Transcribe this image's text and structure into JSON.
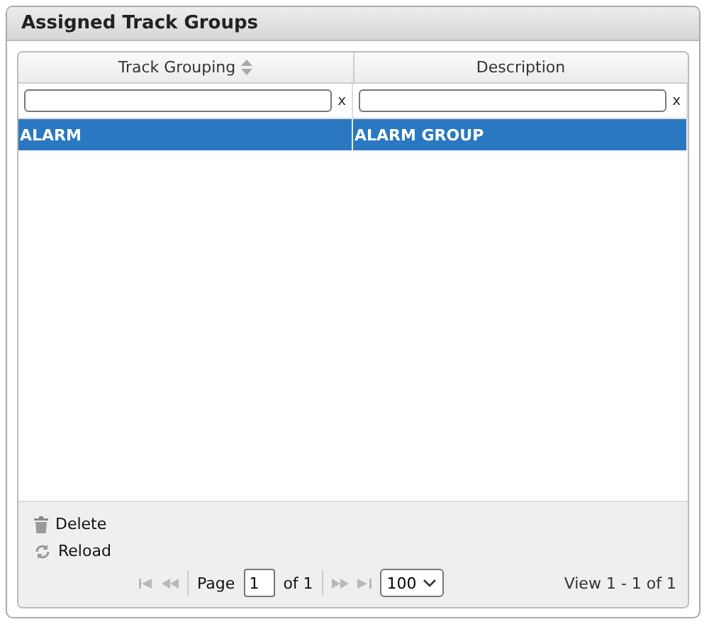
{
  "panel": {
    "title": "Assigned Track Groups"
  },
  "table": {
    "columns": [
      {
        "label": "Track Grouping",
        "sortable": true
      },
      {
        "label": "Description",
        "sortable": false
      }
    ],
    "filters": [
      {
        "clear": "x"
      },
      {
        "clear": "x"
      }
    ],
    "rows": [
      {
        "cells": [
          "ALARM",
          "ALARM GROUP"
        ],
        "selected": true
      }
    ]
  },
  "actions": [
    {
      "kind": "delete",
      "label": "Delete"
    },
    {
      "kind": "reload",
      "label": "Reload"
    }
  ],
  "pager": {
    "nav_disabled": true,
    "page_label": "Page",
    "page": "1",
    "of": "of 1",
    "rows_per_page": "100",
    "view": "View 1 - 1 of 1"
  }
}
